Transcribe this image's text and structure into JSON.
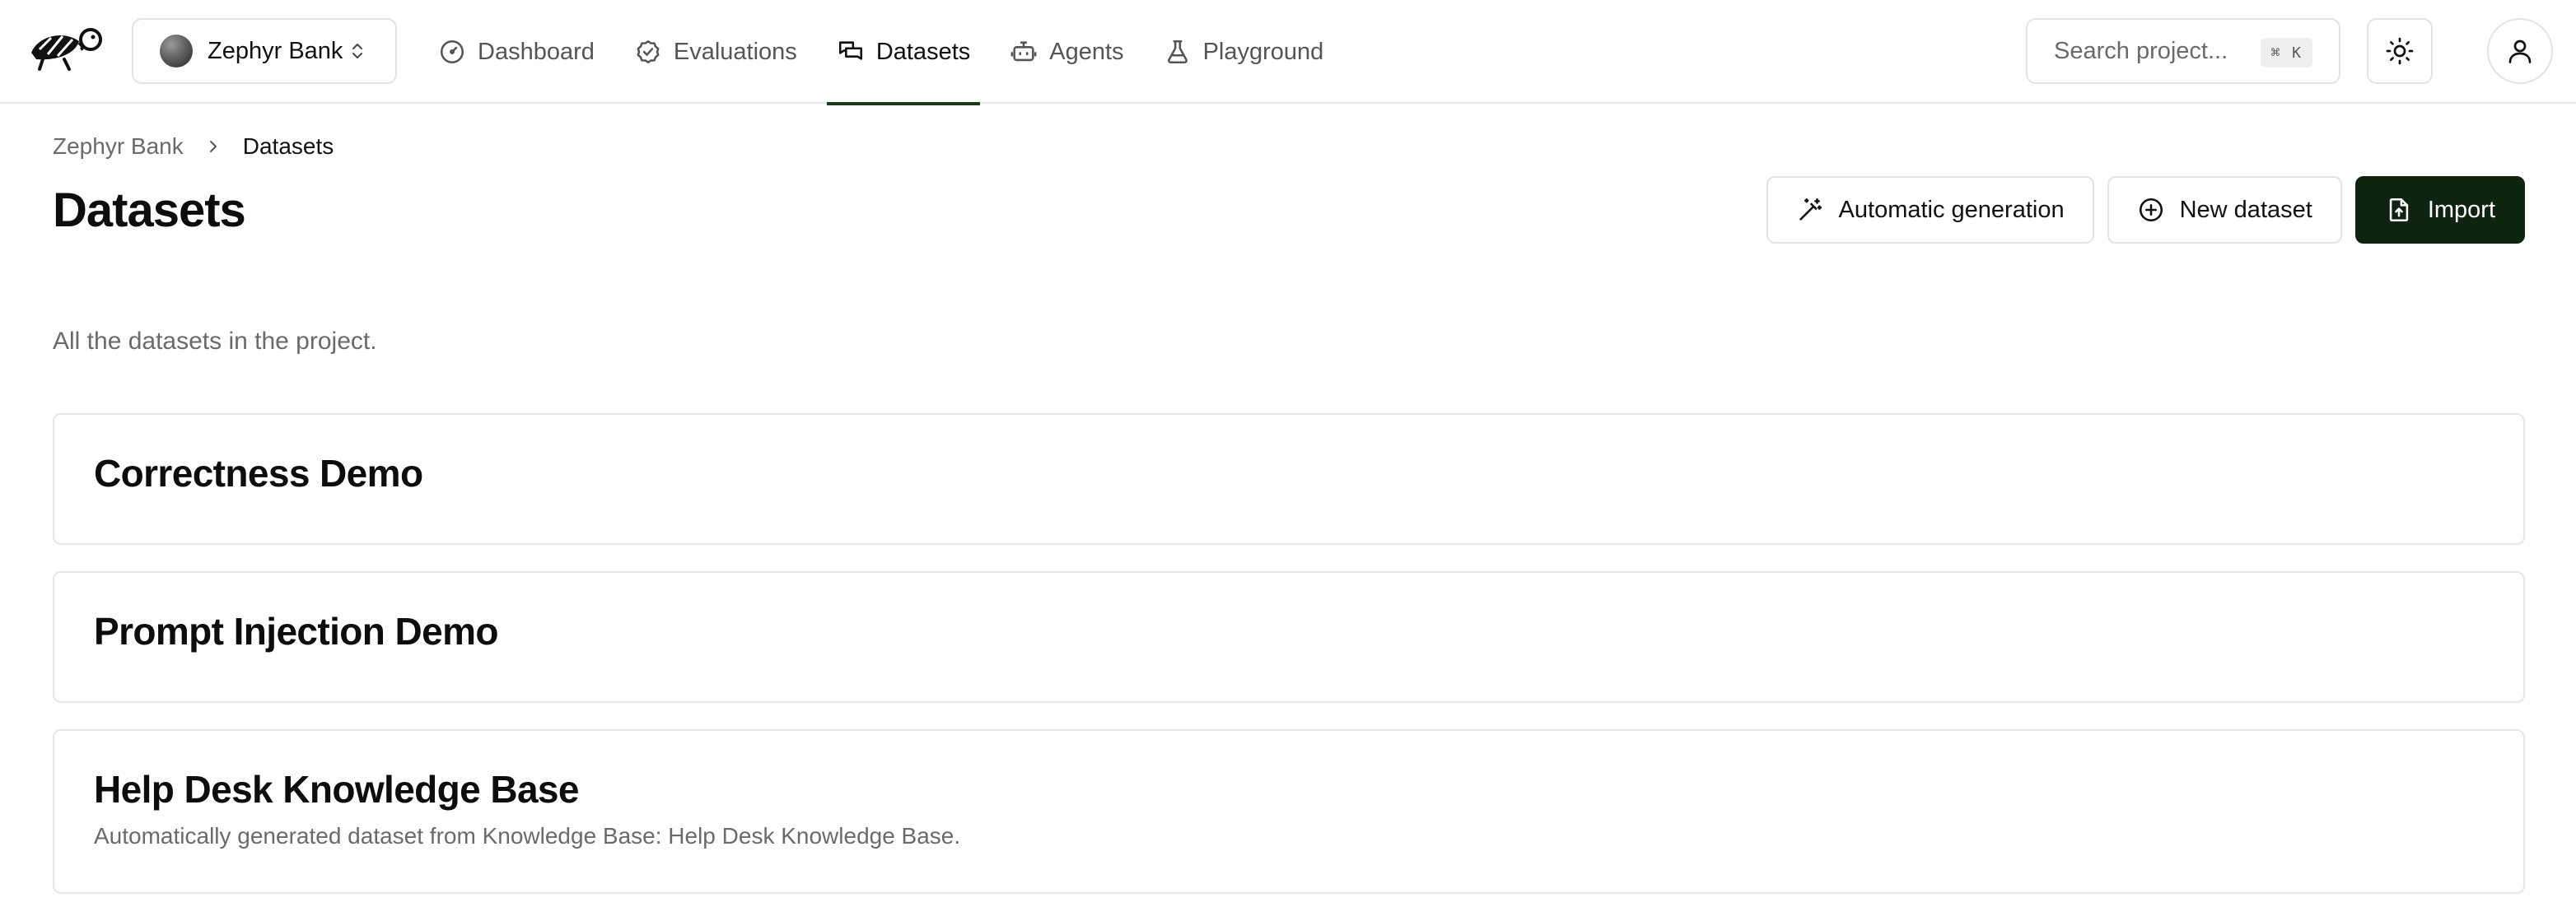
{
  "header": {
    "project_name": "Zephyr Bank",
    "nav": [
      {
        "label": "Dashboard",
        "icon": "gauge-icon",
        "active": false
      },
      {
        "label": "Evaluations",
        "icon": "check-circle-icon",
        "active": false
      },
      {
        "label": "Datasets",
        "icon": "messages-icon",
        "active": true
      },
      {
        "label": "Agents",
        "icon": "bot-icon",
        "active": false
      },
      {
        "label": "Playground",
        "icon": "flask-icon",
        "active": false
      }
    ],
    "search": {
      "placeholder": "Search project...",
      "shortcut": "⌘ K"
    }
  },
  "breadcrumb": {
    "parent": "Zephyr Bank",
    "current": "Datasets"
  },
  "page": {
    "title": "Datasets",
    "subtitle": "All the datasets in the project.",
    "actions": {
      "auto_generate": "Automatic generation",
      "new_dataset": "New dataset",
      "import": "Import"
    }
  },
  "datasets": [
    {
      "name": "Correctness Demo",
      "description": ""
    },
    {
      "name": "Prompt Injection Demo",
      "description": ""
    },
    {
      "name": "Help Desk Knowledge Base",
      "description": "Automatically generated dataset from Knowledge Base: Help Desk Knowledge Base."
    }
  ],
  "colors": {
    "accent": "#0f2410",
    "active_underline": "#1a3a1a",
    "muted_text": "#6a6a6a",
    "border": "#e3e3e3"
  }
}
